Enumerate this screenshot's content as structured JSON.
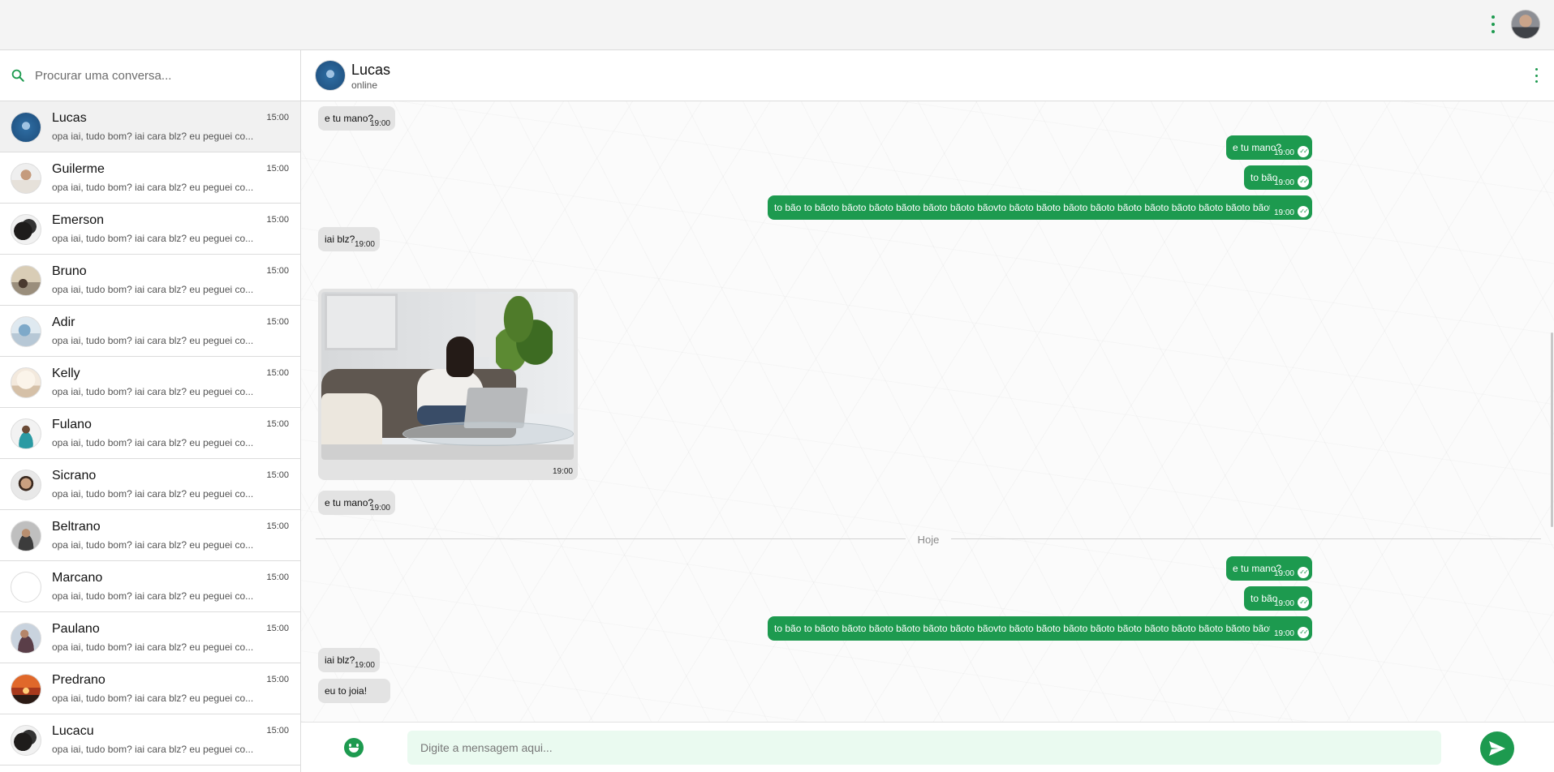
{
  "topbar": {
    "avatar": "user-avatar"
  },
  "search": {
    "placeholder": "Procurar uma conversa..."
  },
  "conversations": [
    {
      "name": "Lucas",
      "time": "15:00",
      "preview": "opa iai, tudo bom? iai cara blz? eu peguei co..."
    },
    {
      "name": "Guilerme",
      "time": "15:00",
      "preview": "opa iai, tudo bom? iai cara blz? eu peguei co..."
    },
    {
      "name": "Emerson",
      "time": "15:00",
      "preview": "opa iai, tudo bom? iai cara blz? eu peguei co..."
    },
    {
      "name": "Bruno",
      "time": "15:00",
      "preview": "opa iai, tudo bom? iai cara blz? eu peguei co..."
    },
    {
      "name": "Adir",
      "time": "15:00",
      "preview": "opa iai, tudo bom? iai cara blz? eu peguei co..."
    },
    {
      "name": "Kelly",
      "time": "15:00",
      "preview": "opa iai, tudo bom? iai cara blz? eu peguei co..."
    },
    {
      "name": "Fulano",
      "time": "15:00",
      "preview": "opa iai, tudo bom? iai cara blz? eu peguei co..."
    },
    {
      "name": "Sicrano",
      "time": "15:00",
      "preview": "opa iai, tudo bom? iai cara blz? eu peguei co..."
    },
    {
      "name": "Beltrano",
      "time": "15:00",
      "preview": "opa iai, tudo bom? iai cara blz? eu peguei co..."
    },
    {
      "name": "Marcano",
      "time": "15:00",
      "preview": "opa iai, tudo bom? iai cara blz? eu peguei co..."
    },
    {
      "name": "Paulano",
      "time": "15:00",
      "preview": "opa iai, tudo bom? iai cara blz? eu peguei co..."
    },
    {
      "name": "Predrano",
      "time": "15:00",
      "preview": "opa iai, tudo bom? iai cara blz? eu peguei co..."
    },
    {
      "name": "Lucacu",
      "time": "15:00",
      "preview": "opa iai, tudo bom? iai cara blz? eu peguei co..."
    }
  ],
  "chat": {
    "name": "Lucas",
    "status": "online",
    "messages": [
      {
        "dir": "in",
        "text": "e tu mano?",
        "time": "19:00"
      },
      {
        "dir": "out",
        "text": "e tu mano?",
        "time": "19:00"
      },
      {
        "dir": "out",
        "text": "to bão",
        "time": "19:00"
      },
      {
        "dir": "out",
        "text": "to bão to bãoto bãoto bãoto bãoto bãoto bãoto bãovto bãoto bãoto bãoto bãoto bãoto bãoto bãoto bãoto bãoto bãoto bãoto bãoto bão",
        "time": "19:00"
      },
      {
        "dir": "in",
        "text": "iai blz?",
        "time": "19:00"
      },
      {
        "dir": "in",
        "type": "image",
        "image": "woman-on-sofa-with-laptop-photo",
        "time": "19:00"
      },
      {
        "dir": "in",
        "text": "e tu mano?",
        "time": "19:00"
      },
      {
        "dir": "out",
        "text": "e tu mano?",
        "time": "19:00"
      },
      {
        "dir": "out",
        "text": "to bão",
        "time": "19:00"
      },
      {
        "dir": "out",
        "text": "to bão to bãoto bãoto bãoto bãoto bãoto bãoto bãovto bãoto bãoto bãoto bãoto bãoto bãoto bãoto bãoto bãoto bãoto bãoto bãoto bão",
        "time": "19:00"
      },
      {
        "dir": "in",
        "text": "iai blz?",
        "time": "19:00"
      },
      {
        "dir": "in",
        "text": "eu to joia!",
        "time": ""
      }
    ],
    "day_divider": "Hoje"
  },
  "composer": {
    "placeholder": "Digite a mensagem aqui...",
    "emoji_icon": "smiley-icon",
    "send_icon": "send-icon"
  },
  "colors": {
    "accent": "#1d9a4f",
    "incoming": "#e3e3e3",
    "input_bg": "#eafaf0"
  }
}
